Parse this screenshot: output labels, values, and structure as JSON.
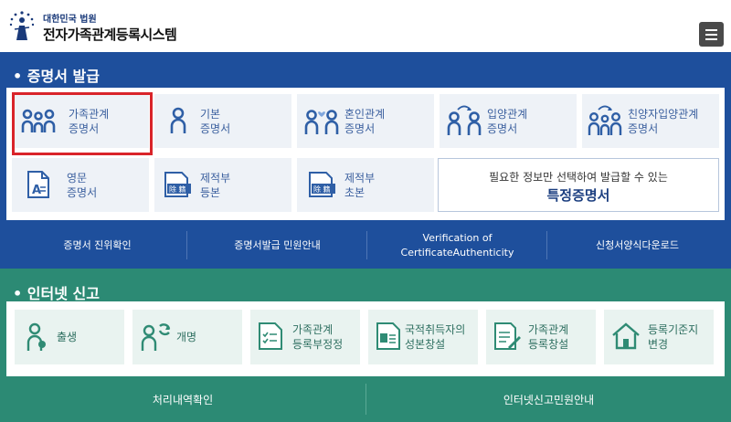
{
  "header": {
    "court_name": "대한민국 법원",
    "system_name": "전자가족관계등록시스템"
  },
  "cert_section": {
    "title": "• 증명서 발급",
    "cards": [
      {
        "label": "가족관계\n증명서",
        "icon": "family-icon"
      },
      {
        "label": "기본\n증명서",
        "icon": "person-icon"
      },
      {
        "label": "혼인관계\n증명서",
        "icon": "couple-heart-icon"
      },
      {
        "label": "입양관계\n증명서",
        "icon": "adoption-icon"
      },
      {
        "label": "친양자입양관계\n증명서",
        "icon": "family-adoption-icon"
      },
      {
        "label": "영문\n증명서",
        "icon": "english-document-icon"
      },
      {
        "label": "제적부\n등본",
        "icon": "register-document-icon"
      },
      {
        "label": "제적부\n초본",
        "icon": "register-document-icon"
      }
    ],
    "special": {
      "sub": "필요한 정보만 선택하여 발급할 수 있는",
      "main": "특정증명서"
    },
    "footer_links": [
      "증명서 진위확인",
      "증명서발급 민원안내",
      "Verification of\nCertificateAuthenticity",
      "신청서양식다운로드"
    ]
  },
  "report_section": {
    "title": "• 인터넷 신고",
    "cards": [
      {
        "label": "출생",
        "icon": "birth-icon"
      },
      {
        "label": "개명",
        "icon": "rename-icon"
      },
      {
        "label": "가족관계\n등록부정정",
        "icon": "correction-document-icon"
      },
      {
        "label": "국적취득자의\n성본창설",
        "icon": "id-card-icon"
      },
      {
        "label": "가족관계\n등록창설",
        "icon": "document-pencil-icon"
      },
      {
        "label": "등록기준지\n변경",
        "icon": "house-icon"
      }
    ],
    "footer_links": [
      "처리내역확인",
      "인터넷신고민원안내"
    ]
  },
  "colors": {
    "cert_blue": "#1e4f9c",
    "report_green": "#2c8a74",
    "highlight_red": "#d9242a"
  }
}
